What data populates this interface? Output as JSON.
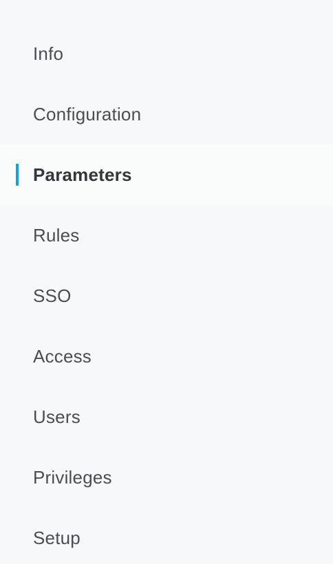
{
  "colors": {
    "background": "#f7f8fa",
    "active_background": "#fafbfb",
    "active_indicator": "#1a9fd6",
    "label_text": "#4a4d52",
    "active_label_text": "#33363b"
  },
  "sidebar": {
    "active_item": "Parameters",
    "items": [
      {
        "label": "Info"
      },
      {
        "label": "Configuration"
      },
      {
        "label": "Parameters"
      },
      {
        "label": "Rules"
      },
      {
        "label": "SSO"
      },
      {
        "label": "Access"
      },
      {
        "label": "Users"
      },
      {
        "label": "Privileges"
      },
      {
        "label": "Setup"
      }
    ]
  }
}
